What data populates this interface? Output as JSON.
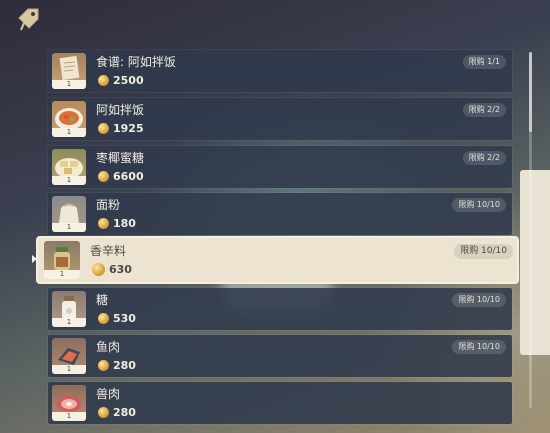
{
  "header": {
    "icon": "price-tag-icon"
  },
  "items": [
    {
      "name": "食谱: 阿如拌饭",
      "price": "2500",
      "limit": "限购 1/1",
      "qty": "1",
      "icon": "recipe-scroll-icon"
    },
    {
      "name": "阿如拌饭",
      "price": "1925",
      "limit": "限购 2/2",
      "qty": "1",
      "icon": "rice-dish-icon"
    },
    {
      "name": "枣椰蜜糖",
      "price": "6600",
      "limit": "限购 2/2",
      "qty": "1",
      "icon": "date-candy-icon"
    },
    {
      "name": "面粉",
      "price": "180",
      "limit": "限购 10/10",
      "qty": "1",
      "icon": "flour-sack-icon"
    },
    {
      "name": "香辛料",
      "price": "630",
      "limit": "限购 10/10",
      "qty": "1",
      "icon": "spice-jar-icon",
      "selected": true
    },
    {
      "name": "糖",
      "price": "530",
      "limit": "限购 10/10",
      "qty": "1",
      "icon": "sugar-jar-icon"
    },
    {
      "name": "鱼肉",
      "price": "280",
      "limit": "限购 10/10",
      "qty": "1",
      "icon": "fish-meat-icon"
    },
    {
      "name": "兽肉",
      "price": "280",
      "limit": "",
      "qty": "1",
      "icon": "raw-meat-icon"
    }
  ],
  "colors": {
    "row_bg": "#303a4c",
    "selected_bg": "#ece4d1",
    "coin": "#d9a23a",
    "text_light": "#f2ece0",
    "text_dark": "#4b4a46"
  }
}
